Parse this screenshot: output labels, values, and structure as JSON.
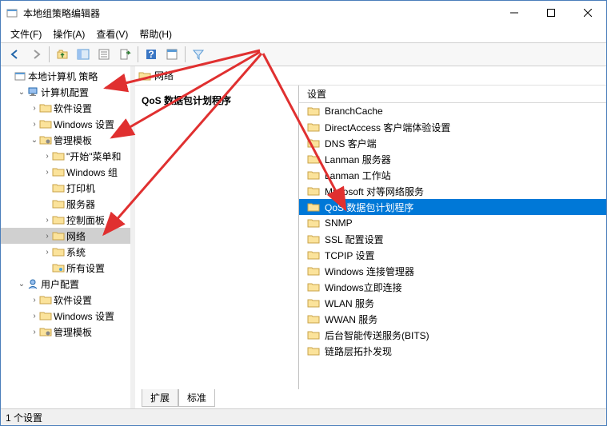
{
  "window": {
    "title": "本地组策略编辑器"
  },
  "menus": {
    "file": "文件(F)",
    "action": "操作(A)",
    "view": "查看(V)",
    "help": "帮助(H)"
  },
  "tree": {
    "root_label": "本地计算机 策略",
    "computer_cfg": "计算机配置",
    "software_settings": "软件设置",
    "windows_settings": "Windows 设置",
    "admin_templates": "管理模板",
    "start_menu": "\"开始\"菜单和",
    "windows_components": "Windows 组",
    "printers": "打印机",
    "server": "服务器",
    "control_panel": "控制面板",
    "network": "网络",
    "system": "系统",
    "all_settings": "所有设置",
    "user_cfg": "用户配置"
  },
  "breadcrumb": {
    "label": "网络"
  },
  "detail": {
    "heading": "QoS 数据包计划程序"
  },
  "list": {
    "header": "设置",
    "items": [
      "BranchCache",
      "DirectAccess 客户端体验设置",
      "DNS 客户端",
      "Lanman 服务器",
      "Lanman 工作站",
      "Microsoft 对等网络服务",
      "QoS 数据包计划程序",
      "SNMP",
      "SSL 配置设置",
      "TCPIP 设置",
      "Windows 连接管理器",
      "Windows立即连接",
      "WLAN 服务",
      "WWAN 服务",
      "后台智能传送服务(BITS)",
      "链路层拓扑发现"
    ],
    "selected_index": 6
  },
  "tabs": {
    "extended": "扩展",
    "standard": "标准"
  },
  "statusbar": {
    "text": "1 个设置"
  }
}
